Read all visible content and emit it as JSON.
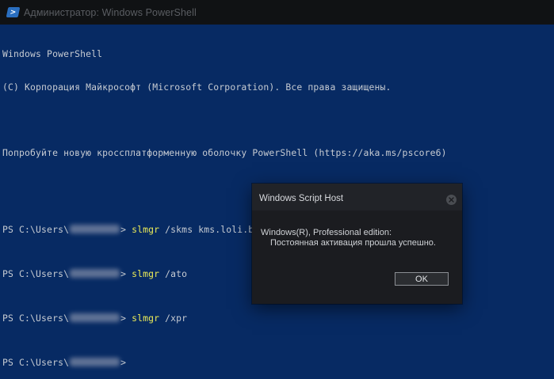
{
  "window": {
    "title": "Администратор: Windows PowerShell",
    "icon": "powershell-icon"
  },
  "console": {
    "header_line1": "Windows PowerShell",
    "header_line2": "(C) Корпорация Майкрософт (Microsoft Corporation). Все права защищены.",
    "header_line4": "Попробуйте новую кроссплатформенную оболочку PowerShell (https://aka.ms/pscore6)",
    "prompt_prefix": "PS C:\\Users\\",
    "prompt_suffix": "> ",
    "commands": [
      {
        "cmd": "slmgr",
        "args": " /skms kms.loli.best"
      },
      {
        "cmd": "slmgr",
        "args": " /ato"
      },
      {
        "cmd": "slmgr",
        "args": " /xpr"
      },
      {
        "cmd": "",
        "args": ""
      }
    ],
    "colors": {
      "background": "#072a63",
      "text": "#c6cbd2",
      "command": "#eaea57"
    }
  },
  "dialog": {
    "title": "Windows Script Host",
    "message_line1": "Windows(R), Professional edition:",
    "message_line2": "Постоянная активация прошла успешно.",
    "ok_label": "OK",
    "close_icon": "close-icon"
  }
}
